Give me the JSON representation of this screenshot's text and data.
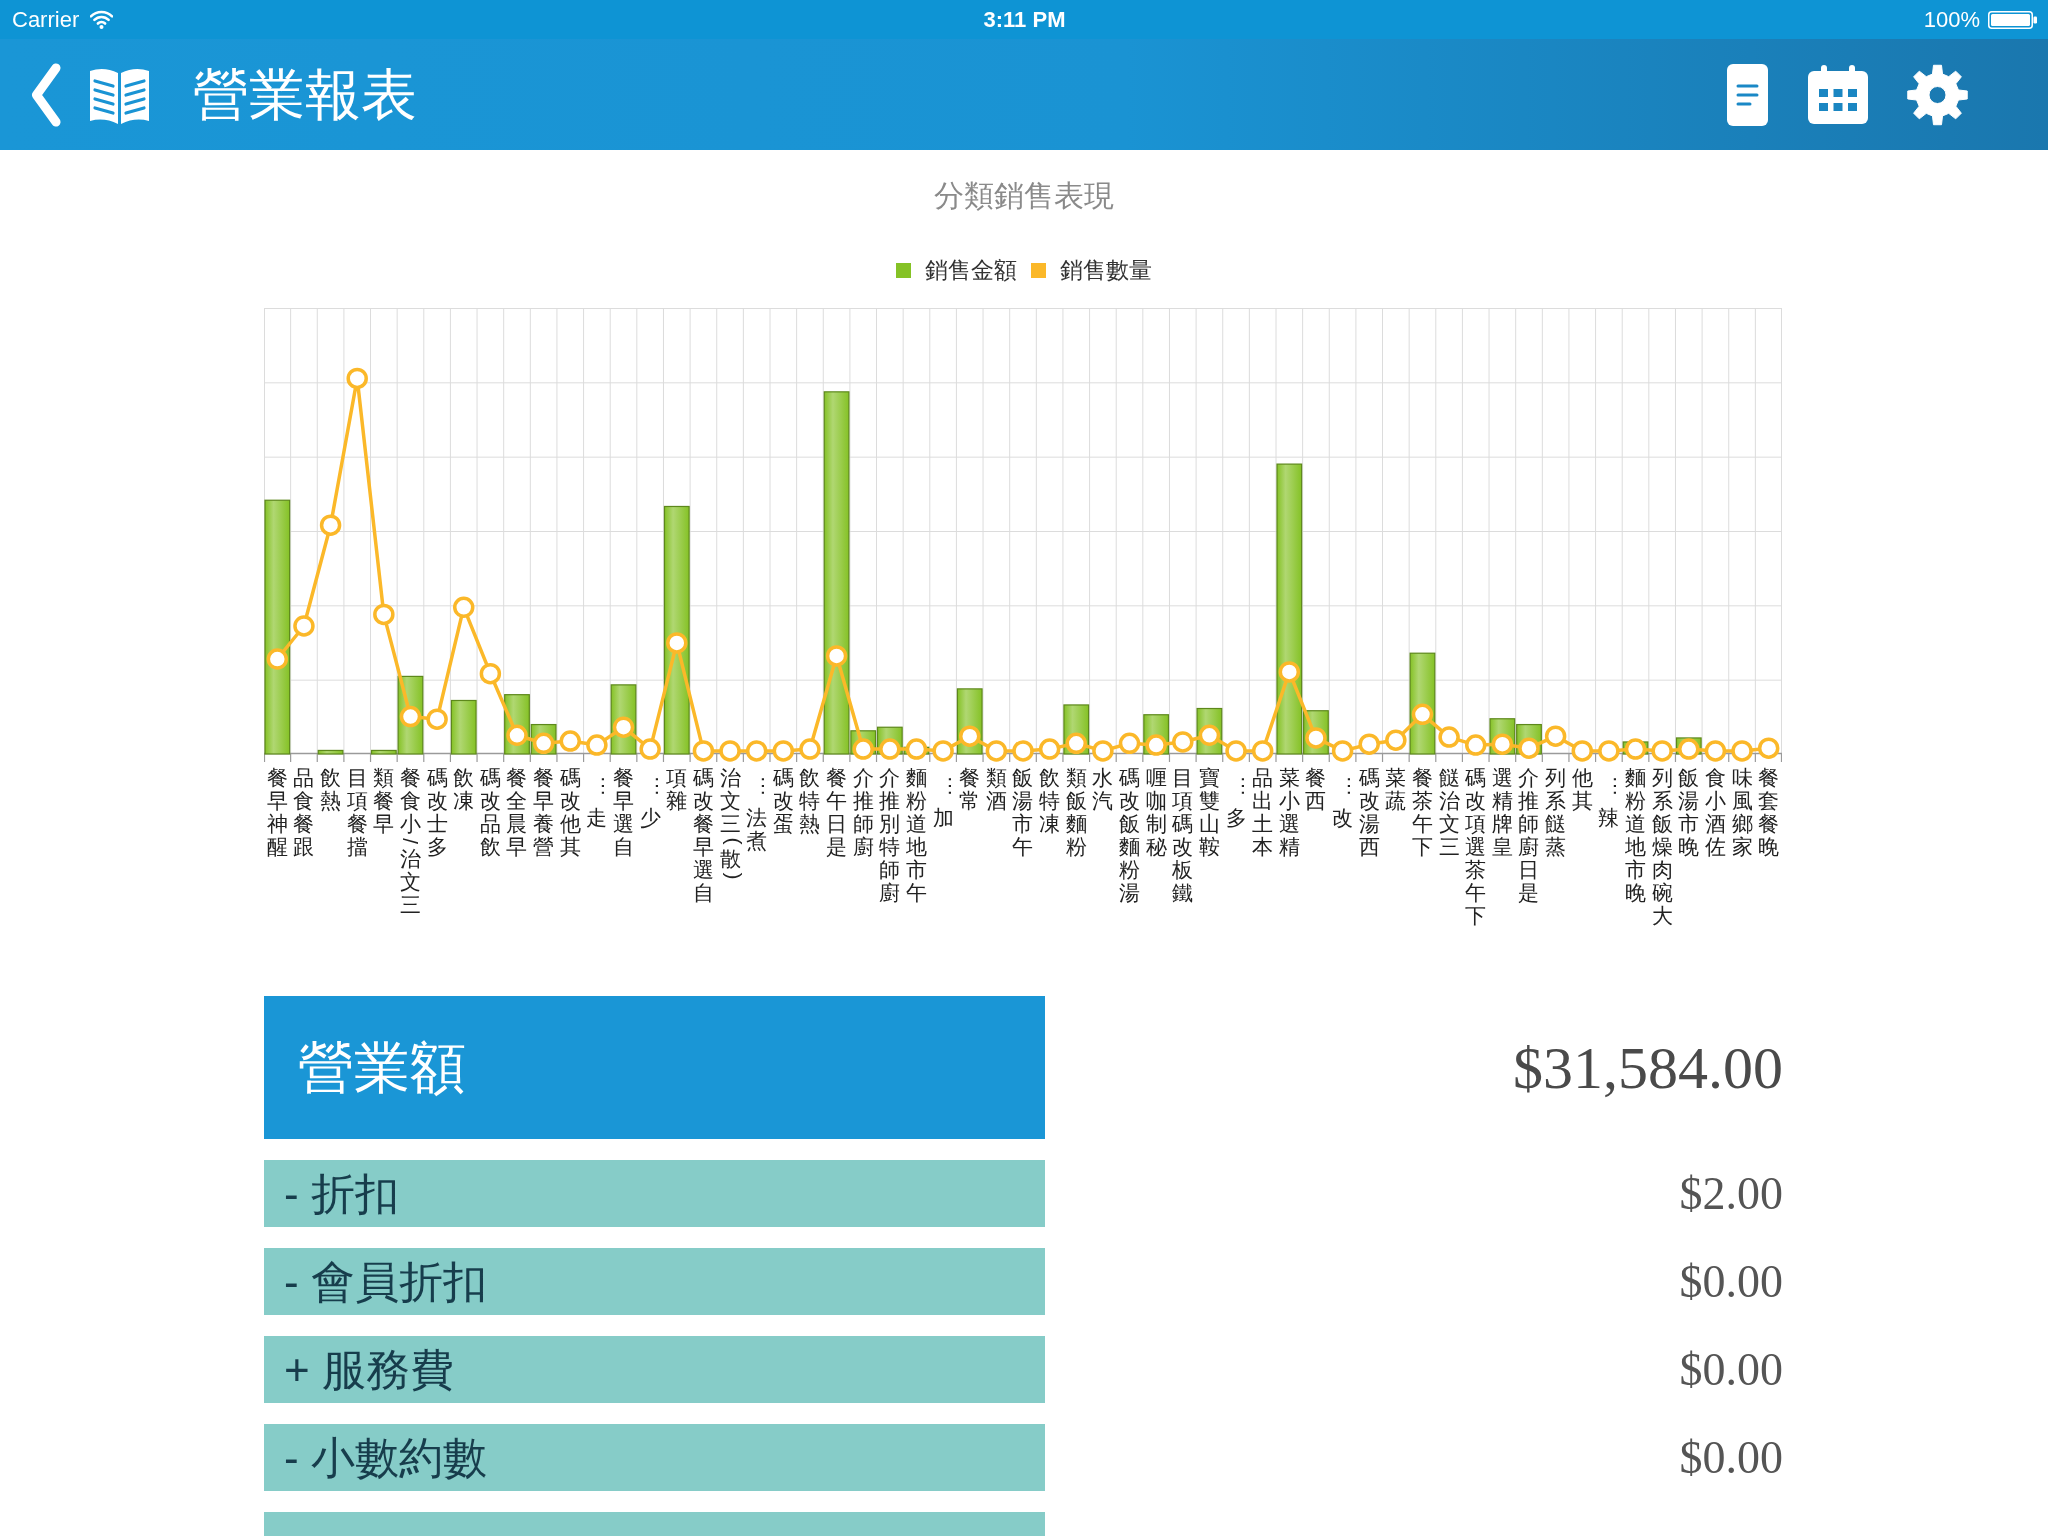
{
  "status_bar": {
    "carrier": "Carrier",
    "time": "3:11 PM",
    "battery": "100%"
  },
  "nav_bar": {
    "title": "營業報表"
  },
  "sales_chart": {
    "title": "分類銷售表現",
    "legend": [
      {
        "label": "銷售金額",
        "color": "#85c226"
      },
      {
        "label": "銷售數量",
        "color": "#fbb829"
      }
    ],
    "categories": [
      "醒神早餐",
      "跟餐食品",
      "熱飲",
      "擋餐項目",
      "早餐類",
      "三文治/小食餐",
      "多士改碼",
      "凍飲",
      "飲品改碼",
      "早晨全餐",
      "營養早餐",
      "其他改碼",
      "走…",
      "自選早餐",
      "少…",
      "雜項",
      "自選早餐改碼",
      "(散)三文治",
      "煮法…",
      "蛋改碼",
      "熱特飲",
      "是日午餐",
      "廚師推介",
      "廚師特別推介",
      "午市地道粉麵",
      "加…",
      "常餐",
      "酒類",
      "午市湯飯",
      "凍特飲",
      "粉麵飯類",
      "汽水",
      "湯粉麵飯改碼",
      "秘制咖喱",
      "鐵板改碼項目",
      "鞍山雙寶",
      "多…",
      "本土出品",
      "精選小菜",
      "西餐",
      "改…",
      "西湯改碼",
      "蔬菜",
      "下午茶餐",
      "三文治餸",
      "下午茶選項改碼",
      "皇牌精選",
      "是日廚師推介",
      "蒸餸系列",
      "其他",
      "辣…",
      "晚市地道粉麵",
      "大碗肉燥飯系列",
      "晚市湯飯",
      "佐酒小食",
      "家鄉風味",
      "晚餐套餐"
    ]
  },
  "summary": {
    "total": {
      "label": "營業額",
      "value": "$31,584.00"
    },
    "rows": [
      {
        "label": "- 折扣",
        "value": "$2.00"
      },
      {
        "label": "- 會員折扣",
        "value": "$0.00"
      },
      {
        "label": "+ 服務費",
        "value": "$0.00"
      },
      {
        "label": "- 小數約數",
        "value": "$0.00"
      },
      {}
    ]
  }
}
